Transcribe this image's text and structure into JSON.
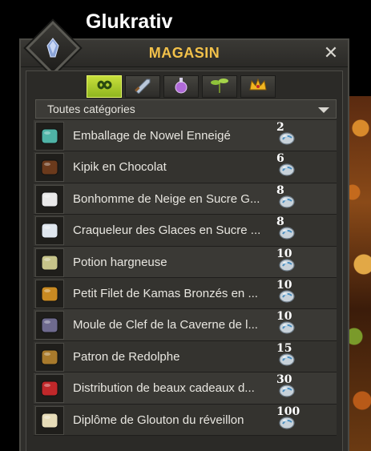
{
  "character_name": "Glukrativ",
  "window": {
    "title": "MAGASIN",
    "close_label": "✕"
  },
  "tabs": [
    {
      "name": "infinity-icon",
      "active": true
    },
    {
      "name": "weapon-icon",
      "active": false
    },
    {
      "name": "potion-icon",
      "active": false
    },
    {
      "name": "plant-icon",
      "active": false
    },
    {
      "name": "crown-icon",
      "active": false
    }
  ],
  "category": {
    "selected": "Toutes catégories"
  },
  "items": [
    {
      "name": "Emballage de Nowel Enneigé",
      "price": "2",
      "icon": "wrapping-paper-icon",
      "color": "#4fb3a6"
    },
    {
      "name": "Kipik en Chocolat",
      "price": "6",
      "icon": "chocolate-icon",
      "color": "#6b3a1c"
    },
    {
      "name": "Bonhomme de Neige en Sucre G...",
      "price": "8",
      "icon": "snowman-icon",
      "color": "#e9e9e9"
    },
    {
      "name": "Craqueleur des Glaces en Sucre ...",
      "price": "8",
      "icon": "ice-creature-icon",
      "color": "#dfe6ee"
    },
    {
      "name": "Potion hargneuse",
      "price": "10",
      "icon": "potion-bottle-icon",
      "color": "#c7c48a"
    },
    {
      "name": "Petit Filet de Kamas Bronzés en ...",
      "price": "10",
      "icon": "net-bag-icon",
      "color": "#c98a22"
    },
    {
      "name": "Moule de Clef de la Caverne de l...",
      "price": "10",
      "icon": "key-mold-icon",
      "color": "#6e6a8e"
    },
    {
      "name": "Patron de Redolphe",
      "price": "15",
      "icon": "reindeer-pattern-icon",
      "color": "#a87a2c"
    },
    {
      "name": "Distribution de beaux cadeaux d...",
      "price": "30",
      "icon": "gift-box-icon",
      "color": "#c0282a"
    },
    {
      "name": "Diplôme de Glouton du réveillon",
      "price": "100",
      "icon": "diploma-icon",
      "color": "#e6dcb8"
    }
  ]
}
